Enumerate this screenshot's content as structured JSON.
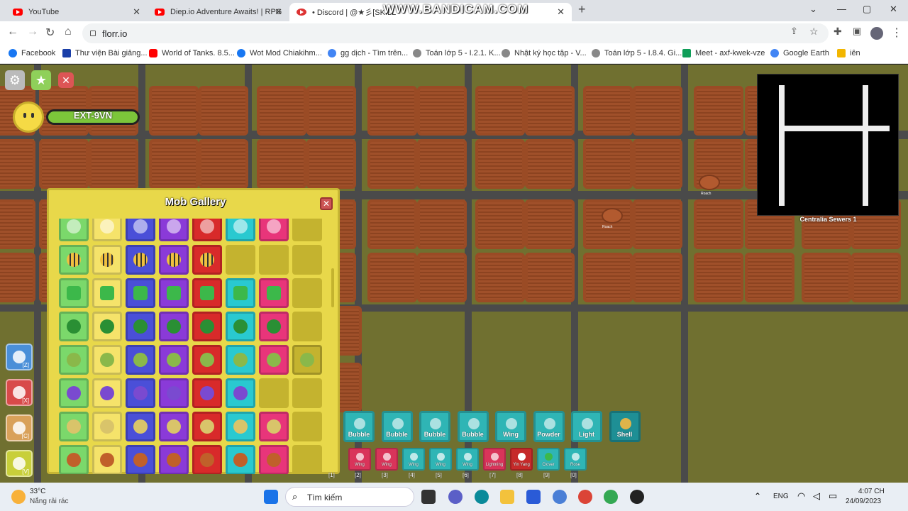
{
  "browser": {
    "tabs": [
      {
        "title": "YouTube",
        "active": false
      },
      {
        "title": "Diep.io Adventure Awaits! | RPG",
        "active": false
      },
      {
        "title": "• Discord | @★彡[SKILL",
        "active": true
      }
    ],
    "recorder_watermark": "WWW.BANDICAM.COM",
    "url": "florr.io",
    "bookmarks": [
      "Facebook",
      "Thư viện Bài giảng...",
      "World of Tanks. 8.5...",
      "Wot Mod Chiakihm...",
      "gg dịch - Tìm trên...",
      "Toán lớp 5 - I.2.1. K...",
      "Nhật ký học tập - V...",
      "Toán lớp 5 - I.8.4. Gi...",
      "Meet - axf-kwek-vze",
      "Google Earth",
      "iên"
    ]
  },
  "game": {
    "player_name": "EXT-9VN",
    "minimap_label": "Centralia Sewers 1",
    "mob_labels": [
      "Roach",
      "Roach"
    ],
    "abilities": [
      {
        "key": "[Z]",
        "color": "#4a8fd8"
      },
      {
        "key": "[X]",
        "color": "#d84a4a"
      },
      {
        "key": "[C]",
        "color": "#d9a15a"
      },
      {
        "key": "[V]",
        "color": "#c8cf3a"
      }
    ],
    "gallery": {
      "title": "Mob Gallery",
      "rarity_colors": [
        "#7bd86b",
        "#f5e36a",
        "#4a4fd8",
        "#8a3ad8",
        "#d82a2a",
        "#29c9d0",
        "#e8357a",
        "#c4b32f"
      ],
      "rows": [
        {
          "icon": "bubble",
          "filled": 7
        },
        {
          "icon": "bee",
          "filled": 5
        },
        {
          "icon": "starfish",
          "filled": 7
        },
        {
          "icon": "cactus",
          "filled": 7
        },
        {
          "icon": "snail",
          "filled": 8
        },
        {
          "icon": "snail-purple",
          "filled": 6
        },
        {
          "icon": "snail-tan",
          "filled": 7
        },
        {
          "icon": "ant",
          "filled": 7
        }
      ]
    },
    "loadout_primary": [
      "Bubble",
      "Bubble",
      "Bubble",
      "Bubble",
      "Wing",
      "Powder",
      "Light",
      "Shell"
    ],
    "loadout_secondary": [
      {
        "label": "",
        "key": "[1]"
      },
      {
        "label": "Wing",
        "key": "[2]"
      },
      {
        "label": "Wing",
        "key": "[3]"
      },
      {
        "label": "Wing",
        "key": "[4]"
      },
      {
        "label": "Wing",
        "key": "[5]"
      },
      {
        "label": "Wing",
        "key": "[6]"
      },
      {
        "label": "Lightning",
        "key": "[7]"
      },
      {
        "label": "Yin Yang",
        "key": "[8]"
      },
      {
        "label": "Clover",
        "key": "[9]"
      },
      {
        "label": "Rose",
        "key": "[0]"
      }
    ]
  },
  "taskbar": {
    "weather_temp": "33°C",
    "weather_desc": "Nắng rải rác",
    "search_placeholder": "Tìm kiếm",
    "language": "ENG",
    "time": "4:07 CH",
    "date": "24/09/2023"
  }
}
